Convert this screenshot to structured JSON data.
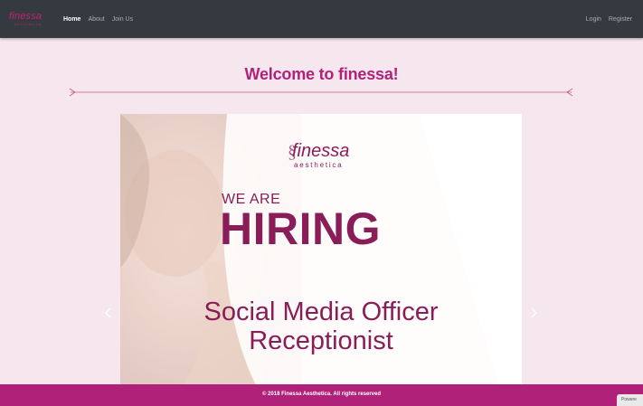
{
  "brand": {
    "name": "finessa",
    "tagline": "aesthetica"
  },
  "nav": {
    "left": [
      {
        "label": "Home",
        "active": true
      },
      {
        "label": "About",
        "active": false
      },
      {
        "label": "Join Us",
        "active": false
      }
    ],
    "right": [
      {
        "label": "Login"
      },
      {
        "label": "Register"
      }
    ]
  },
  "main": {
    "heading": "Welcome to finessa!",
    "carousel": {
      "prev_icon": "chevron-left-icon",
      "next_icon": "chevron-right-icon",
      "slide": {
        "logo_name": "finessa",
        "logo_tagline": "aesthetica",
        "we_are": "WE ARE",
        "hiring": "HIRING",
        "job_1": "Social Media Officer",
        "job_2": "Receptionist"
      }
    }
  },
  "footer": {
    "text": "© 2018 Finessa Aesthetica. All rights reserved"
  },
  "badge": {
    "text": "Powere"
  },
  "colors": {
    "navbar": "#343a40",
    "accent": "#b0227a",
    "page_bg": "#f6e6ee",
    "ad_text": "#8a1d58"
  }
}
